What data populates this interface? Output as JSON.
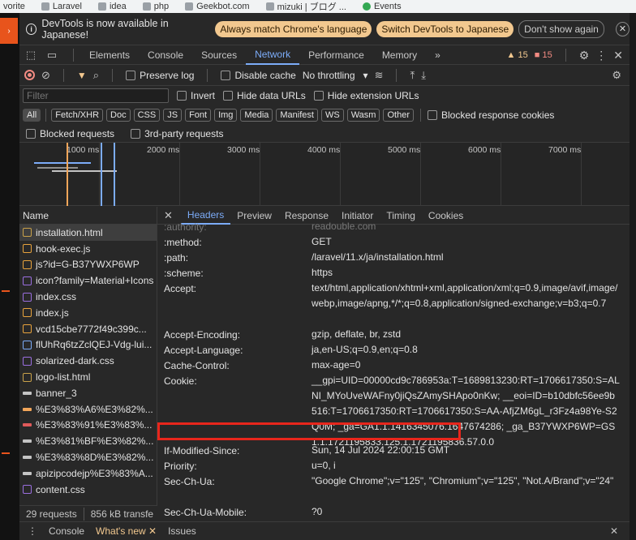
{
  "bookmarks": [
    "vorite",
    "Laravel",
    "idea",
    "php",
    "Geekbot.com",
    "mizuki | ブログ ...",
    "Events"
  ],
  "infobar": {
    "message": "DevTools is now available in Japanese!",
    "match_btn": "Always match Chrome's language",
    "switch_btn": "Switch DevTools to Japanese",
    "dont_show_btn": "Don't show again"
  },
  "main_tabs": [
    "Elements",
    "Console",
    "Sources",
    "Network",
    "Performance",
    "Memory"
  ],
  "main_active": "Network",
  "more_tabs": "»",
  "warnings_count": "15",
  "errors_count": "15",
  "toolbar": {
    "preserve_log": "Preserve log",
    "disable_cache": "Disable cache",
    "throttling": "No throttling"
  },
  "filter": {
    "placeholder": "Filter",
    "invert": "Invert",
    "hide_data_urls": "Hide data URLs",
    "hide_extension_urls": "Hide extension URLs"
  },
  "types": [
    "All",
    "Fetch/XHR",
    "Doc",
    "CSS",
    "JS",
    "Font",
    "Img",
    "Media",
    "Manifest",
    "WS",
    "Wasm",
    "Other"
  ],
  "blocked_response_cookies": "Blocked response cookies",
  "blocked_requests": "Blocked requests",
  "third_party_requests": "3rd-party requests",
  "timeline_labels": [
    "1000 ms",
    "2000 ms",
    "3000 ms",
    "4000 ms",
    "5000 ms",
    "6000 ms",
    "7000 ms"
  ],
  "request_list": {
    "header": "Name",
    "items": [
      {
        "name": "installation.html",
        "type": "doc"
      },
      {
        "name": "hook-exec.js",
        "type": "js"
      },
      {
        "name": "js?id=G-B37YWXP6WP",
        "type": "js"
      },
      {
        "name": "icon?family=Material+Icons",
        "type": "css"
      },
      {
        "name": "index.css",
        "type": "css"
      },
      {
        "name": "index.js",
        "type": "js"
      },
      {
        "name": "vcd15cbe7772f49c399c...",
        "type": "js"
      },
      {
        "name": "flUhRq6tzZclQEJ-Vdg-lui...",
        "type": "font"
      },
      {
        "name": "solarized-dark.css",
        "type": "css"
      },
      {
        "name": "logo-list.html",
        "type": "doc"
      },
      {
        "name": "banner_3",
        "type": "img"
      },
      {
        "name": "%E3%83%A6%E3%82%...",
        "type": "img-orange"
      },
      {
        "name": "%E3%83%91%E3%83%...",
        "type": "img-red"
      },
      {
        "name": "%E3%81%BF%E3%82%...",
        "type": "img"
      },
      {
        "name": "%E3%83%8D%E3%82%...",
        "type": "img"
      },
      {
        "name": "apizipcodejp%E3%83%A...",
        "type": "img"
      },
      {
        "name": "content.css",
        "type": "css"
      }
    ]
  },
  "status": {
    "requests": "29 requests",
    "transferred": "856 kB transfe"
  },
  "detail_tabs": [
    "Headers",
    "Preview",
    "Response",
    "Initiator",
    "Timing",
    "Cookies"
  ],
  "detail_active": "Headers",
  "headers": [
    {
      "name": ":authority:",
      "value": "readouble.com"
    },
    {
      "name": ":method:",
      "value": "GET"
    },
    {
      "name": ":path:",
      "value": "/laravel/11.x/ja/installation.html"
    },
    {
      "name": ":scheme:",
      "value": "https"
    },
    {
      "name": "Accept:",
      "value": "text/html,application/xhtml+xml,application/xml;q=0.9,image/avif,image/webp,image/apng,*/*;q=0.8,application/signed-exchange;v=b3;q=0.7"
    },
    {
      "name": "Accept-Encoding:",
      "value": "gzip, deflate, br, zstd"
    },
    {
      "name": "Accept-Language:",
      "value": "ja,en-US;q=0.9,en;q=0.8"
    },
    {
      "name": "Cache-Control:",
      "value": "max-age=0"
    },
    {
      "name": "Cookie:",
      "value": "__gpi=UID=00000cd9c786953a:T=1689813230:RT=1706617350:S=ALNI_MYoUveWAFny0jiQsZAmySHApo0nKw; __eoi=ID=b10dbfc56ee9b516:T=1706617350:RT=1706617350:S=AA-AfjZM6gL_r3Fz4a98Ye-S2Q0M; _ga=GA1.1.1416345076.1647674286; _ga_B37YWXP6WP=GS1.1.1721195833.125.1.1721195836.57.0.0"
    },
    {
      "name": "If-Modified-Since:",
      "value": "Sun, 14 Jul 2024 22:00:15 GMT"
    },
    {
      "name": "Priority:",
      "value": "u=0, i"
    },
    {
      "name": "Sec-Ch-Ua:",
      "value": "\"Google Chrome\";v=\"125\", \"Chromium\";v=\"125\", \"Not.A/Brand\";v=\"24\""
    },
    {
      "name": "Sec-Ch-Ua-Mobile:",
      "value": "?0"
    }
  ],
  "drawer_tabs": [
    "Console",
    "What's new",
    "Issues"
  ],
  "drawer_active": "What's new",
  "colors": {
    "accent": "#7cacf8",
    "highlight": "#e8261c",
    "pill": "#f2c88f"
  }
}
